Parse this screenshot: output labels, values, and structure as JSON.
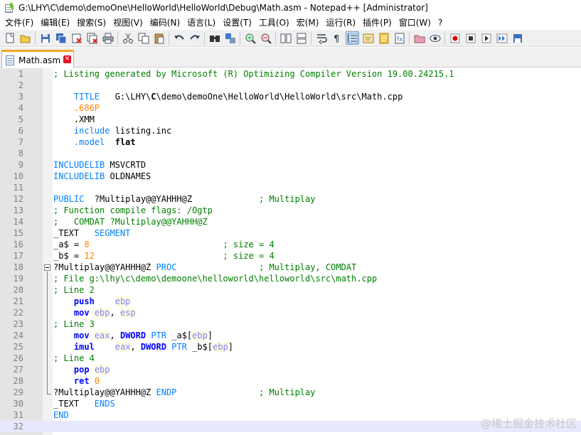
{
  "window": {
    "title": "G:\\LHY\\C\\demo\\demoOne\\HelloWorld\\HelloWorld\\Debug\\Math.asm - Notepad++ [Administrator]"
  },
  "menu": [
    "文件(F)",
    "编辑(E)",
    "搜索(S)",
    "视图(V)",
    "编码(N)",
    "语言(L)",
    "设置(T)",
    "工具(O)",
    "宏(M)",
    "运行(R)",
    "插件(P)",
    "窗口(W)",
    "?"
  ],
  "toolbar": {
    "icons": [
      "new-file-icon",
      "open-file-icon",
      "save-icon",
      "save-all-icon",
      "close-icon",
      "close-all-icon",
      "print-icon",
      "cut-icon",
      "copy-icon",
      "paste-icon",
      "undo-icon",
      "redo-icon",
      "find-icon",
      "replace-icon",
      "zoom-in-icon",
      "zoom-out-icon",
      "sync-vertical-icon",
      "sync-horizontal-icon",
      "word-wrap-icon",
      "show-all-chars-icon",
      "indent-guide-icon",
      "udl-icon",
      "doc-map-icon",
      "function-list-icon",
      "folder-workspace-icon",
      "monitoring-icon",
      "record-macro-icon",
      "stop-record-icon",
      "play-macro-icon",
      "run-macro-multiple-icon",
      "save-macro-icon"
    ]
  },
  "tab": {
    "label": "Math.asm"
  },
  "editor": {
    "lines": [
      [
        [
          "cmt",
          "; Listing generated by Microsoft (R) Optimizing Compiler Version 19.00.24215.1"
        ]
      ],
      [],
      [
        [
          "txt",
          "    "
        ],
        [
          "kw",
          "TITLE"
        ],
        [
          "txt",
          "   G:\\LHY\\"
        ],
        [
          "bold",
          "C"
        ],
        [
          "txt",
          "\\demo\\demoOne\\HelloWorld\\HelloWorld\\src\\Math.cpp"
        ]
      ],
      [
        [
          "txt",
          "    "
        ],
        [
          "dir",
          ".686P"
        ]
      ],
      [
        [
          "txt",
          "    .XMM"
        ]
      ],
      [
        [
          "txt",
          "    "
        ],
        [
          "kw",
          "include"
        ],
        [
          "txt",
          " listing.inc"
        ]
      ],
      [
        [
          "txt",
          "    "
        ],
        [
          "kw",
          ".model"
        ],
        [
          "txt",
          "  "
        ],
        [
          "bold",
          "flat"
        ]
      ],
      [],
      [
        [
          "kw",
          "INCLUDELIB"
        ],
        [
          "txt",
          " MSVCRTD"
        ]
      ],
      [
        [
          "kw",
          "INCLUDELIB"
        ],
        [
          "txt",
          " OLDNAMES"
        ]
      ],
      [],
      [
        [
          "kw",
          "PUBLIC"
        ],
        [
          "txt",
          "  ?Multiplay@@YAHHH@Z             "
        ],
        [
          "cmt",
          "; Multiplay"
        ]
      ],
      [
        [
          "cmt",
          "; Function compile flags: /Ogtp"
        ]
      ],
      [
        [
          "cmt",
          ";   COMDAT ?Multiplay@@YAHHH@Z"
        ]
      ],
      [
        [
          "txt",
          "_TEXT   "
        ],
        [
          "kw",
          "SEGMENT"
        ]
      ],
      [
        [
          "txt",
          "_a$ = "
        ],
        [
          "num",
          "8"
        ],
        [
          "txt",
          "                          "
        ],
        [
          "cmt",
          "; size = 4"
        ]
      ],
      [
        [
          "txt",
          "_b$ = "
        ],
        [
          "num",
          "12"
        ],
        [
          "txt",
          "                         "
        ],
        [
          "cmt",
          "; size = 4"
        ]
      ],
      [
        [
          "txt",
          "?Multiplay@@YAHHH@Z "
        ],
        [
          "kw",
          "PROC"
        ],
        [
          "txt",
          "                "
        ],
        [
          "cmt",
          "; Multiplay, COMDAT"
        ]
      ],
      [
        [
          "cmt",
          "; File g:\\lhy\\c\\demo\\demoone\\helloworld\\helloworld\\src\\math.cpp"
        ]
      ],
      [
        [
          "cmt",
          "; Line 2"
        ]
      ],
      [
        [
          "txt",
          "    "
        ],
        [
          "ins",
          "push"
        ],
        [
          "txt",
          "    "
        ],
        [
          "reg",
          "ebp"
        ]
      ],
      [
        [
          "txt",
          "    "
        ],
        [
          "ins",
          "mov"
        ],
        [
          "txt",
          " "
        ],
        [
          "reg",
          "ebp"
        ],
        [
          "txt",
          ", "
        ],
        [
          "reg",
          "esp"
        ]
      ],
      [
        [
          "cmt",
          "; Line 3"
        ]
      ],
      [
        [
          "txt",
          "    "
        ],
        [
          "ins",
          "mov"
        ],
        [
          "txt",
          " "
        ],
        [
          "reg",
          "eax"
        ],
        [
          "txt",
          ", "
        ],
        [
          "ins",
          "DWORD"
        ],
        [
          "txt",
          " "
        ],
        [
          "kw",
          "PTR"
        ],
        [
          "txt",
          " _a$["
        ],
        [
          "reg",
          "ebp"
        ],
        [
          "txt",
          "]"
        ]
      ],
      [
        [
          "txt",
          "    "
        ],
        [
          "ins",
          "imul"
        ],
        [
          "txt",
          "    "
        ],
        [
          "reg",
          "eax"
        ],
        [
          "txt",
          ", "
        ],
        [
          "ins",
          "DWORD"
        ],
        [
          "txt",
          " "
        ],
        [
          "kw",
          "PTR"
        ],
        [
          "txt",
          " _b$["
        ],
        [
          "reg",
          "ebp"
        ],
        [
          "txt",
          "]"
        ]
      ],
      [
        [
          "cmt",
          "; Line 4"
        ]
      ],
      [
        [
          "txt",
          "    "
        ],
        [
          "ins",
          "pop"
        ],
        [
          "txt",
          " "
        ],
        [
          "reg",
          "ebp"
        ]
      ],
      [
        [
          "txt",
          "    "
        ],
        [
          "ins",
          "ret"
        ],
        [
          "txt",
          " "
        ],
        [
          "num",
          "0"
        ]
      ],
      [
        [
          "txt",
          "?Multiplay@@YAHHH@Z "
        ],
        [
          "kw",
          "ENDP"
        ],
        [
          "txt",
          "                "
        ],
        [
          "cmt",
          "; Multiplay"
        ]
      ],
      [
        [
          "txt",
          "_TEXT   "
        ],
        [
          "kw",
          "ENDS"
        ]
      ],
      [
        [
          "kw",
          "END"
        ]
      ],
      []
    ],
    "current_line": 32
  },
  "watermark": "@稀土掘金技术社区"
}
